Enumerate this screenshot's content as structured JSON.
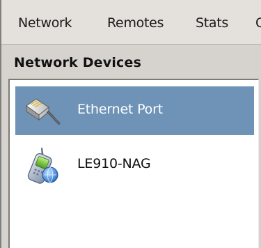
{
  "tabs": [
    {
      "label": "Network"
    },
    {
      "label": "Remotes"
    },
    {
      "label": "Stats"
    },
    {
      "label": "C"
    }
  ],
  "panel": {
    "title": "Network Devices"
  },
  "devices": [
    {
      "label": "Ethernet Port",
      "icon": "ethernet-port-icon",
      "selected": true
    },
    {
      "label": "LE910-NAG",
      "icon": "cellular-phone-network-icon",
      "selected": false
    }
  ],
  "colors": {
    "selection": "#6e93b7",
    "window_bg": "#d6d3ce",
    "list_bg": "#ffffff"
  }
}
